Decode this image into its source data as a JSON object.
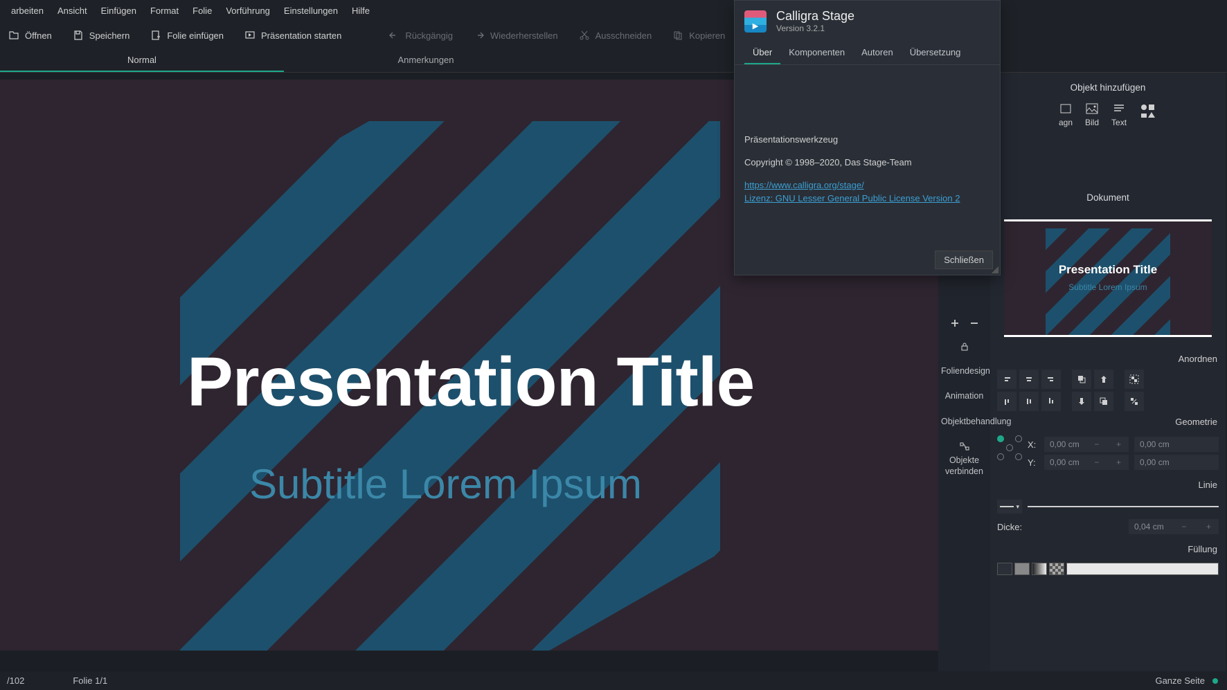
{
  "menubar": [
    "arbeiten",
    "Ansicht",
    "Einfügen",
    "Format",
    "Folie",
    "Vorführung",
    "Einstellungen",
    "Hilfe"
  ],
  "toolbar": {
    "open": "Öffnen",
    "save": "Speichern",
    "insert_slide": "Folie einfügen",
    "start_presentation": "Präsentation starten",
    "undo": "Rückgängig",
    "redo": "Wiederherstellen",
    "cut": "Ausschneiden",
    "copy": "Kopieren"
  },
  "tabs": {
    "normal": "Normal",
    "notes": "Anmerkungen"
  },
  "slide": {
    "title": "Presentation Title",
    "subtitle": "Subtitle Lorem Ipsum"
  },
  "statusbar": {
    "page_ratio": "/102",
    "slide": "Folie 1/1",
    "zoom_label": "Ganze Seite"
  },
  "panel": {
    "add_object": "Objekt hinzufügen",
    "diag": "agn",
    "image": "Bild",
    "text": "Text",
    "document": "Dokument",
    "arrange": "Anordnen",
    "geometry": "Geometrie",
    "x": "X:",
    "y": "Y:",
    "val_zero": "0,00 cm",
    "line": "Linie",
    "thickness": "Dicke:",
    "thickness_val": "0,04 cm",
    "fill": "Füllung",
    "vtab_design": "Foliendesign",
    "vtab_animation": "Animation",
    "vtab_treatment": "Objektbehandlung",
    "vtab_connect": "Objekte verbinden"
  },
  "about": {
    "app": "Calligra Stage",
    "version": "Version 3.2.1",
    "tabs": [
      "Über",
      "Komponenten",
      "Autoren",
      "Übersetzung"
    ],
    "desc": "Präsentationswerkzeug",
    "copyright": "Copyright © 1998–2020, Das Stage-Team",
    "link": "https://www.calligra.org/stage/",
    "license": "Lizenz: GNU Lesser General Public License Version 2",
    "close": "Schließen"
  }
}
